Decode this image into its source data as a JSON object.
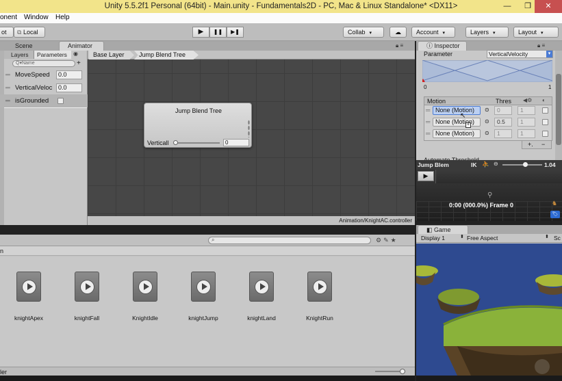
{
  "window": {
    "title": "Unity 5.5.2f1 Personal (64bit) - Main.unity - Fundamentals2D - PC, Mac & Linux Standalone* <DX11>",
    "minimize": "—",
    "maximize": "❐",
    "close": "✕"
  },
  "menu": {
    "items": [
      "onent",
      "Window",
      "Help"
    ]
  },
  "toolbar": {
    "pivot_label": "ot",
    "local_label": "Local",
    "play": "▶",
    "pause": "❚❚",
    "step": "▶❚",
    "collab": "Collab",
    "account": "Account",
    "layers": "Layers",
    "layout": "Layout",
    "arrow": "▾"
  },
  "tabs": {
    "scene": "Scene",
    "animator": "Animator",
    "inspector": "Inspector",
    "game": "Game"
  },
  "animator": {
    "subtabs": [
      "Layers",
      "Parameters"
    ],
    "search_placeholder": "Q▾Name",
    "add": "+",
    "breadcrumb": [
      "Base Layer",
      "Jump Blend Tree"
    ],
    "parameters": [
      {
        "name": "MoveSpeed",
        "value": "0.0"
      },
      {
        "name": "VerticalVeloc",
        "value": "0.0"
      },
      {
        "name": "isGrounded",
        "value": ""
      }
    ],
    "node": {
      "title": "Jump Blend Tree",
      "param": "Verticall",
      "value": "0"
    },
    "controller_path": "Animation/KnightAC.controller"
  },
  "inspector": {
    "parameter_label": "Parameter",
    "parameter_value": "VerticalVelocity",
    "range_min": "0",
    "range_max": "1",
    "col_motion": "Motion",
    "col_thres": "Thres",
    "rows": [
      {
        "motion": "None (Motion)",
        "threshold": "0",
        "speed": "1"
      },
      {
        "motion": "None (Motion)",
        "threshold": "0.5",
        "speed": "1"
      },
      {
        "motion": "None (Motion)",
        "threshold": "1",
        "speed": "1"
      }
    ],
    "add": "+.",
    "remove": "−",
    "automate": "Automate Threshold"
  },
  "preview": {
    "name": "Jump Blem",
    "ik": "IK",
    "speed": "1.04",
    "time": "0:00 (000.0%) Frame 0"
  },
  "game": {
    "display": "Display 1",
    "aspect": "Free Aspect",
    "scale": "Sc"
  },
  "project": {
    "header_left": "n",
    "bottom_left": "ler",
    "clips": [
      "knightApex",
      "knightFall",
      "KnightIdle",
      "knightJump",
      "knightLand",
      "KnightRun"
    ]
  },
  "colors": {
    "titlebar": "#f2e48a",
    "graph_bg": "#474747",
    "sky": "#2e4a90",
    "grass": "#8ab23a"
  }
}
